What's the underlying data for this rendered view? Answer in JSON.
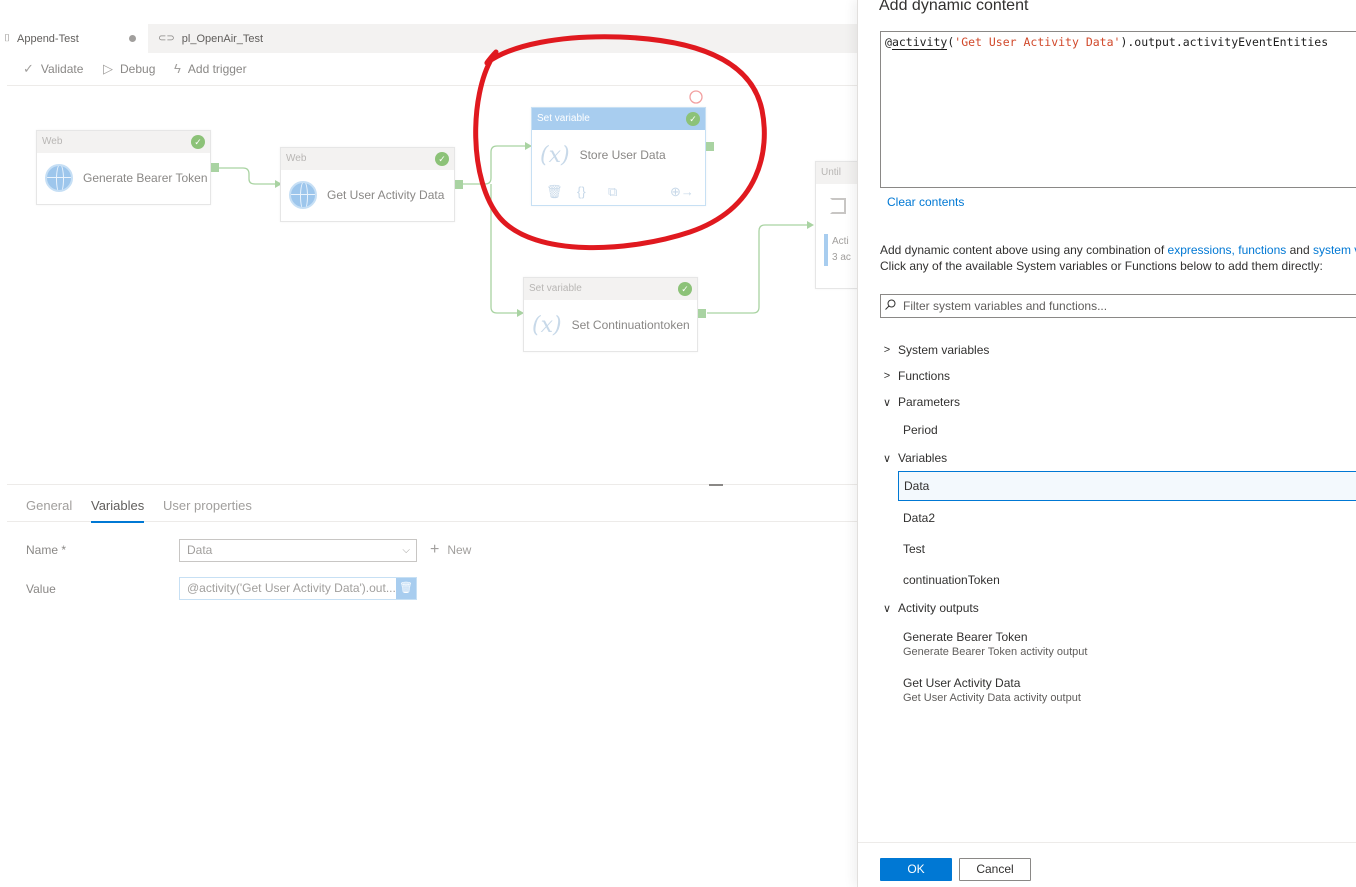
{
  "tabs": [
    {
      "label": "Append-Test",
      "modified": true
    },
    {
      "label": "pl_OpenAir_Test"
    }
  ],
  "toolbar": {
    "validate": "Validate",
    "debug": "Debug",
    "add_trigger": "Add trigger"
  },
  "activities": {
    "generate_token": {
      "type": "Web",
      "name": "Generate Bearer Token",
      "status": "succeeded"
    },
    "get_user_activity": {
      "type": "Web",
      "name": "Get User Activity Data",
      "status": "succeeded"
    },
    "store_user_data": {
      "type": "Set variable",
      "name": "Store User Data",
      "status": "succeeded"
    },
    "set_continuation": {
      "type": "Set variable",
      "name": "Set Continuationtoken",
      "status": "succeeded"
    },
    "until": {
      "type": "Until",
      "inner_label": "Acti",
      "inner_count": "3 ac"
    }
  },
  "properties": {
    "tabs": [
      "General",
      "Variables",
      "User properties"
    ],
    "active_tab": "Variables",
    "name_label": "Name *",
    "name_value": "Data",
    "new_label": "New",
    "value_label": "Value",
    "value_text": "@activity('Get User Activity Data').out..."
  },
  "panel": {
    "title": "Add dynamic content",
    "expression": {
      "at": "@",
      "fn": "activity",
      "open": "(",
      "arg": "'Get User Activity Data'",
      "rest": ").output.activityEventEntities"
    },
    "clear_contents": "Clear contents",
    "help_line1_prefix": "Add dynamic content above using any combination of ",
    "help_link_expressions": "expressions,",
    "help_link_functions": "functions",
    "help_and": " and ",
    "help_link_system": "system var",
    "help_line2": "Click any of the available System variables or Functions below to add them directly:",
    "filter_placeholder": "Filter system variables and functions...",
    "groups": {
      "system_variables": "System variables",
      "functions": "Functions",
      "parameters": "Parameters",
      "variables": "Variables",
      "activity_outputs": "Activity outputs"
    },
    "parameters": [
      "Period"
    ],
    "variables": [
      "Data",
      "Data2",
      "Test",
      "continuationToken"
    ],
    "selected_variable": "Data",
    "activity_outputs": [
      {
        "name": "Generate Bearer Token",
        "desc": "Generate Bearer Token activity output"
      },
      {
        "name": "Get User Activity Data",
        "desc": "Get User Activity Data activity output"
      }
    ],
    "ok": "OK",
    "cancel": "Cancel"
  },
  "colors": {
    "accent": "#0078d4",
    "success": "#8cc278",
    "annotation": "#e0191f",
    "selected_header": "#a8cdef"
  }
}
